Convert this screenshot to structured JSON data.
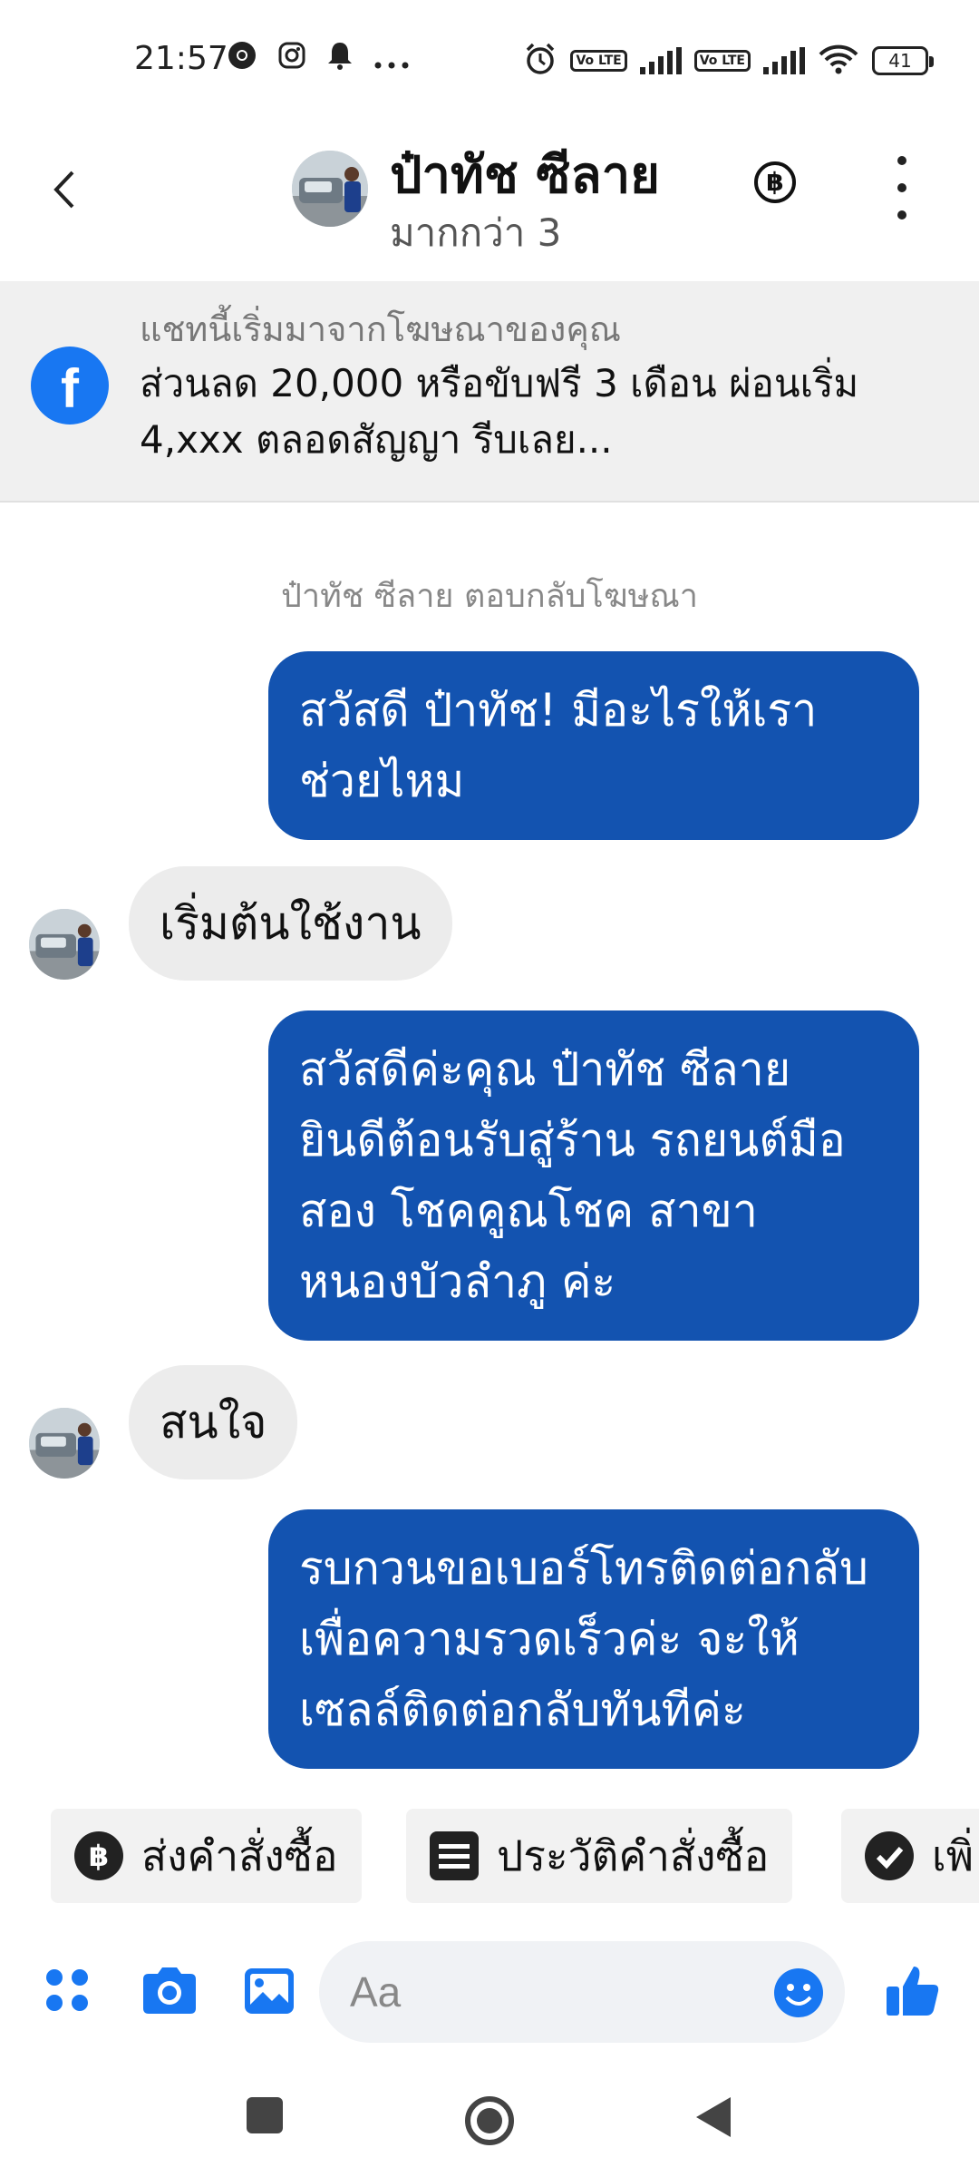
{
  "status_bar": {
    "time": "21:57",
    "battery": "41",
    "volte_label": "Vo LTE",
    "icons": [
      "chrome-icon",
      "instagram-icon",
      "bell-icon",
      "more-dots-icon",
      "alarm-icon",
      "volte-icon",
      "signal-icon",
      "wifi-icon",
      "battery-icon"
    ]
  },
  "header": {
    "name": "ป๋าทัช ซีลาย",
    "subtitle": "มากกว่า 3",
    "baht_symbol": "฿"
  },
  "ad_banner": {
    "caption": "แชทนี้เริ่มมาจากโฆษณาของคุณ",
    "text": "ส่วนลด 20,000 หรือขับฟรี 3 เดือน ผ่อนเริ่ม 4,xxx ตลอดสัญญา รีบเลย..."
  },
  "chat": {
    "reply_note": "ป๋าทัช ซีลาย ตอบกลับโฆษณา",
    "messages": [
      {
        "from": "page",
        "text": "สวัสดี ป๋าทัช! มีอะไรให้เราช่วยไหม"
      },
      {
        "from": "user",
        "text": "เริ่มต้นใช้งาน"
      },
      {
        "from": "page",
        "text": "สวัสดีค่ะคุณ ป๋าทัช ซีลาย ยินดีต้อนรับสู่ร้าน รถยนต์มือสอง โชคคูณโชค สาขาหนองบัวลำภู ค่ะ"
      },
      {
        "from": "user",
        "text": "สนใจ"
      },
      {
        "from": "page",
        "text": "รบกวนขอเบอร์โทรติดต่อกลับเพื่อความรวดเร็วค่ะ จะให้เซลล์ติดต่อกลับทันทีค่ะ"
      }
    ]
  },
  "quick_replies": [
    {
      "icon": "baht-icon",
      "label": "ส่งคำสั่งซื้อ"
    },
    {
      "icon": "receipt-list-icon",
      "label": "ประวัติคำสั่งซื้อ"
    },
    {
      "icon": "check-circle-icon",
      "label": "เพิ่"
    }
  ],
  "composer": {
    "placeholder": "Aa"
  },
  "colors": {
    "outgoing_bubble": "#1353b0",
    "incoming_bubble": "#ececec",
    "messenger_blue": "#1877f2"
  }
}
